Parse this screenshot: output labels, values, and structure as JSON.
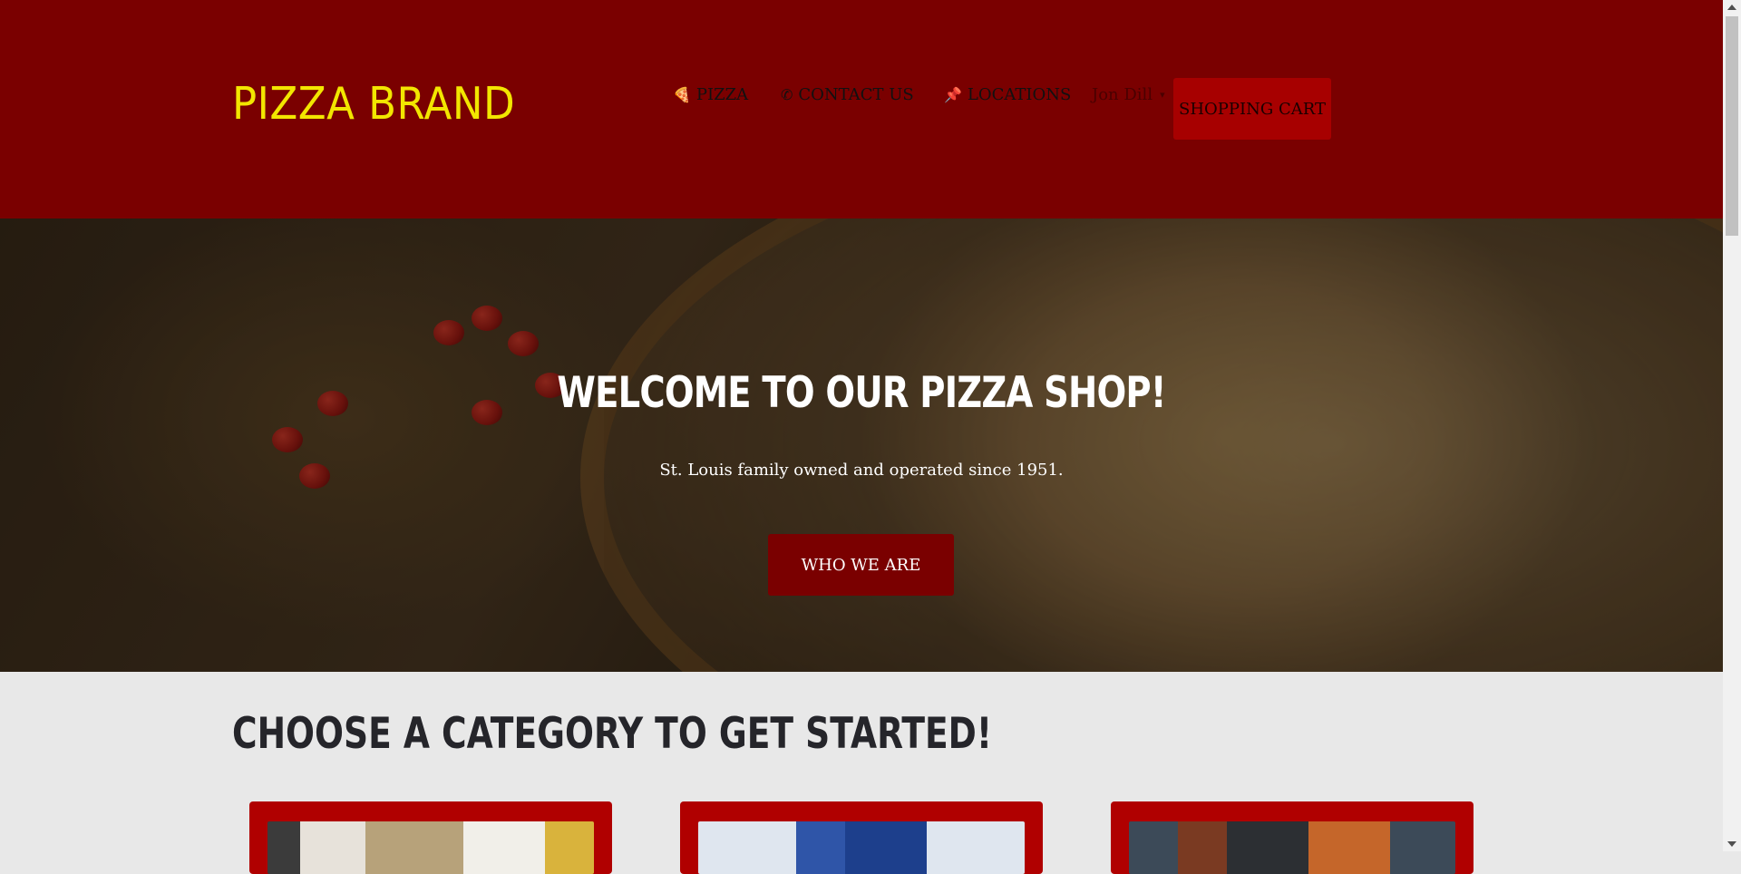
{
  "header": {
    "brand": "PIZZA BRAND",
    "nav": [
      {
        "label": "PIZZA",
        "icon": "pizza-slice-icon",
        "glyph": "🍕"
      },
      {
        "label": "CONTACT US",
        "icon": "phone-icon",
        "glyph": "✆"
      },
      {
        "label": "LOCATIONS",
        "icon": "pin-icon",
        "glyph": "📌"
      }
    ],
    "user": {
      "name": "Jon Dill",
      "caret": "▾"
    },
    "cart_label": "SHOPPING CART",
    "colors": {
      "background": "#7a0000",
      "brand": "#f2e600",
      "cart": "#a70000"
    }
  },
  "hero": {
    "title": "WELCOME TO OUR PIZZA SHOP!",
    "subtitle": "St. Louis family owned and operated since 1951.",
    "button_label": "WHO WE ARE"
  },
  "categories": {
    "heading": "CHOOSE A CATEGORY TO GET STARTED!",
    "cards": [
      {
        "name": "category-card-pizza-dough"
      },
      {
        "name": "category-card-drinks"
      },
      {
        "name": "category-card-appetizers"
      }
    ]
  }
}
